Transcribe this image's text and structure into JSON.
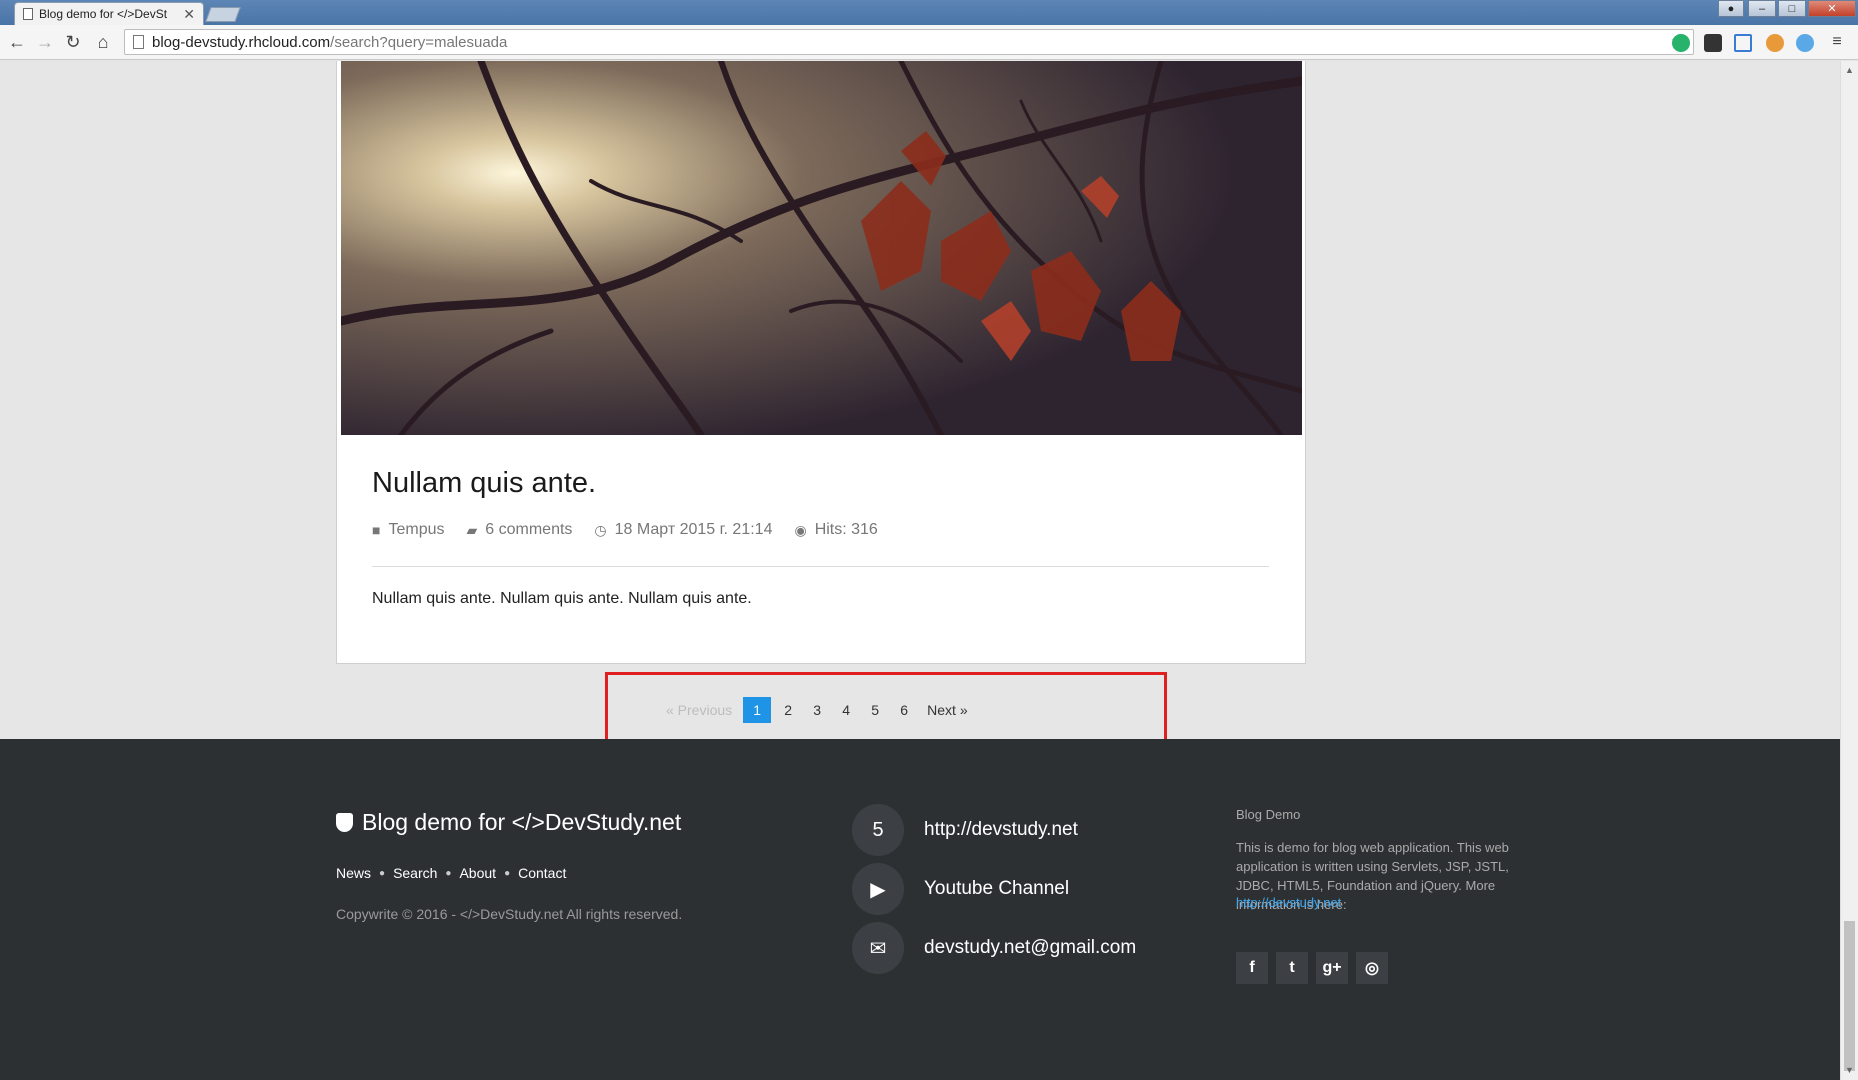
{
  "browser": {
    "tab_title": "Blog demo for </>DevSt",
    "url_host": "blog-devstudy.rhcloud.com",
    "url_path": "/search?query=malesuada"
  },
  "post": {
    "title": "Nullam quis ante.",
    "category": "Tempus",
    "comments": "6 comments",
    "date": "18 Март 2015 г. 21:14",
    "hits": "Hits: 316",
    "excerpt": "Nullam quis ante. Nullam quis ante. Nullam quis ante."
  },
  "pagination": {
    "previous": "« Previous",
    "pages": [
      "1",
      "2",
      "3",
      "4",
      "5",
      "6"
    ],
    "current": "1",
    "next": "Next »"
  },
  "footer": {
    "brand": "Blog demo for </>DevStudy.net",
    "links": [
      "News",
      "Search",
      "About",
      "Contact"
    ],
    "copyright": "Copywrite © 2016 - </>DevStudy.net All rights reserved.",
    "contacts": [
      {
        "icon": "html5-icon",
        "label": "http://devstudy.net"
      },
      {
        "icon": "youtube-icon",
        "label": "Youtube Channel"
      },
      {
        "icon": "envelope-icon",
        "label": "devstudy.net@gmail.com"
      }
    ],
    "about_title": "Blog Demo",
    "about_text": "This is demo for blog web application. This web application is written using Servlets, JSP, JSTL, JDBC, HTML5, Foundation and jQuery. More information is here:",
    "about_link": "http://devstudy.net",
    "social": [
      "facebook-icon",
      "twitter-icon",
      "google-plus-icon",
      "github-icon"
    ]
  },
  "colors": {
    "accent": "#1f94e6",
    "footer_bg": "#2d3033",
    "highlight": "#e02020"
  }
}
